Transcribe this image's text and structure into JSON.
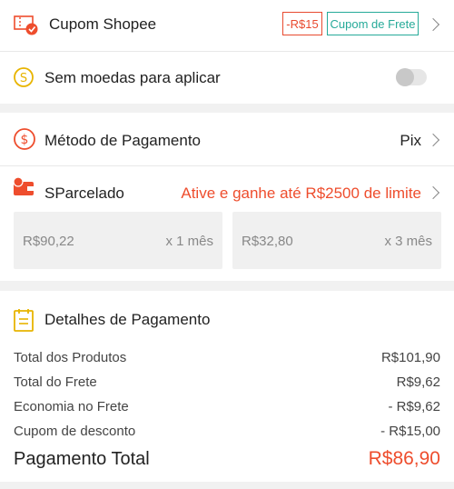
{
  "voucher": {
    "label": "Cupom Shopee",
    "tag_discount": "-R$15",
    "tag_shipping": "Cupom de Frete",
    "icon": "voucher-icon"
  },
  "coins": {
    "label": "Sem moedas para aplicar",
    "icon": "coin-icon",
    "toggle_on": false
  },
  "payment_method": {
    "label": "Método de Pagamento",
    "value": "Pix",
    "icon": "dollar-circle-icon"
  },
  "sparcelado": {
    "label": "SParcelado",
    "promo": "Ative e ganhe até R$2500 de limite",
    "icon": "wallet-icon",
    "options": [
      {
        "amount": "R$90,22",
        "months": "x 1 mês"
      },
      {
        "amount": "R$32,80",
        "months": "x 3 mês"
      }
    ]
  },
  "details": {
    "title": "Detalhes de Pagamento",
    "icon": "clipboard-icon",
    "rows": [
      {
        "label": "Total dos Produtos",
        "value": "R$101,90"
      },
      {
        "label": "Total do Frete",
        "value": "R$9,62"
      },
      {
        "label": "Economia no Frete",
        "value": "- R$9,62"
      },
      {
        "label": "Cupom de desconto",
        "value": "- R$15,00"
      }
    ],
    "total_label": "Pagamento Total",
    "total_value": "R$86,90"
  },
  "colors": {
    "accent": "#ee4d2d",
    "teal": "#26aa99",
    "coin": "#e8b400"
  }
}
